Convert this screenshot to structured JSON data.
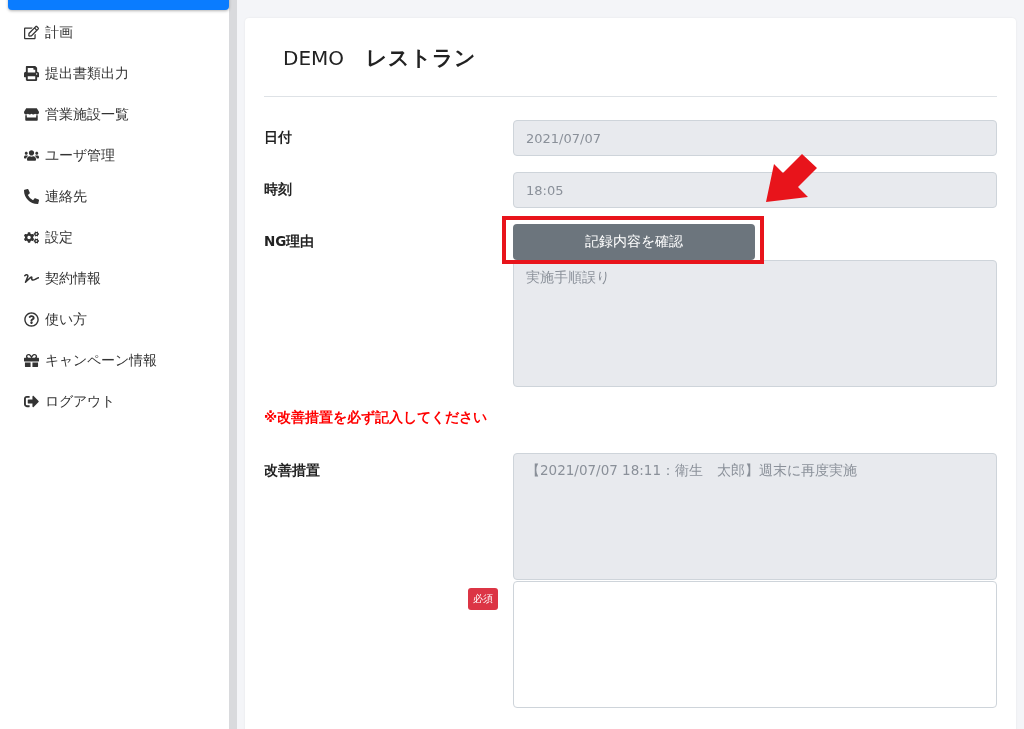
{
  "sidebar": {
    "items": [
      {
        "label": "計画",
        "selected": false
      },
      {
        "label": "提出書類出力",
        "selected": false
      },
      {
        "label": "営業施設一覧",
        "selected": false
      },
      {
        "label": "ユーザ管理",
        "selected": false
      },
      {
        "label": "連絡先",
        "selected": false
      },
      {
        "label": "設定",
        "selected": false
      },
      {
        "label": "契約情報",
        "selected": false
      },
      {
        "label": "使い方",
        "selected": false
      },
      {
        "label": "キャンペーン情報",
        "selected": false
      },
      {
        "label": "ログアウト",
        "selected": false
      }
    ]
  },
  "header": {
    "company": "DEMO",
    "facility": "レストラン"
  },
  "form": {
    "date": {
      "label": "日付",
      "value": "2021/07/07"
    },
    "time": {
      "label": "時刻",
      "value": "18:05"
    },
    "ng_reason": {
      "label": "NG理由",
      "button": "記録内容を確認",
      "value": "実施手順誤り"
    },
    "warning": "※改善措置を必ず記入してください",
    "improvement": {
      "label": "改善措置",
      "history": "【2021/07/07 18:11：衛生　太郎】週末に再度実施",
      "badge": "必須"
    }
  }
}
